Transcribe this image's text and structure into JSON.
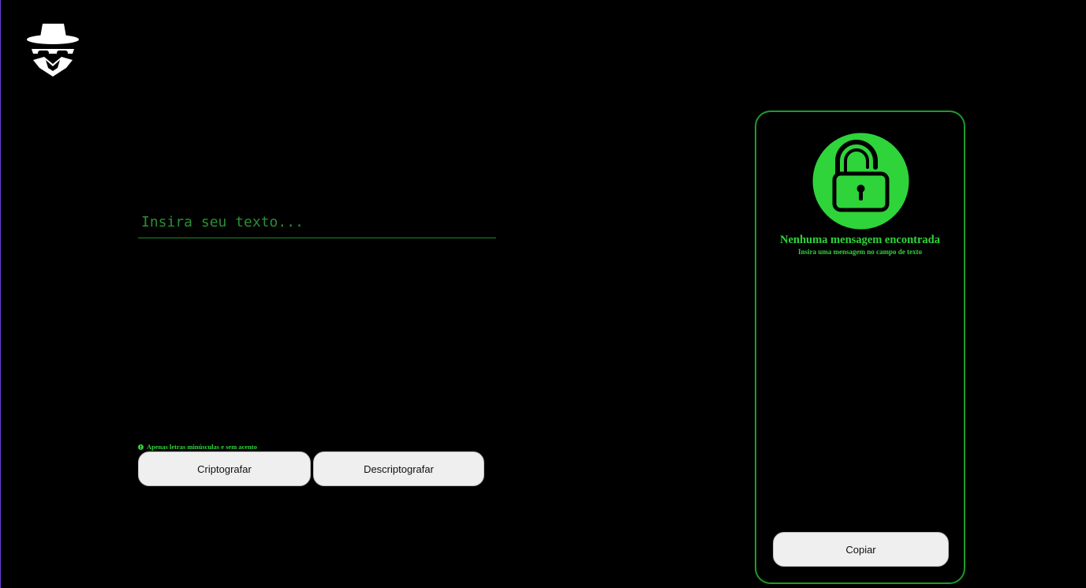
{
  "header": {
    "logo_icon": "incognito-agent-icon"
  },
  "input": {
    "placeholder": "Insira seu texto...",
    "value": ""
  },
  "hint": {
    "icon": "info-circle-icon",
    "text": "Apenas letras minúsculas e sem acento"
  },
  "actions": {
    "encrypt_label": "Criptografar",
    "decrypt_label": "Descriptografar"
  },
  "output": {
    "icon": "lock-icon",
    "title": "Nenhuma mensagem encontrada",
    "subtitle": "Insira uma mensagem no campo de texto",
    "copy_label": "Copiar"
  },
  "colors": {
    "background": "#000000",
    "accent": "#2ed43a",
    "border": "#1f9a2a",
    "button": "#efefef"
  }
}
